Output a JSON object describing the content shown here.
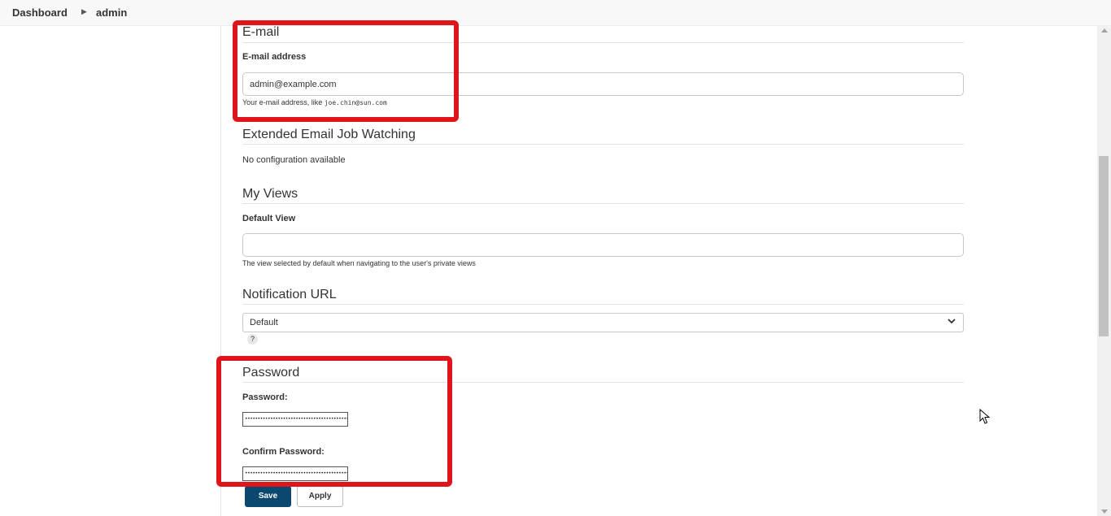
{
  "breadcrumb": {
    "items": [
      "Dashboard",
      "admin"
    ],
    "separator_icon": "chevron-right-icon"
  },
  "email": {
    "section_title": "E-mail",
    "field_label": "E-mail address",
    "value": "admin@example.com",
    "help_prefix": "Your e-mail address, like",
    "help_example": "joe.chin@sun.com"
  },
  "extended_email": {
    "section_title": "Extended Email Job Watching",
    "message": "No configuration available"
  },
  "my_views": {
    "section_title": "My Views",
    "field_label": "Default View",
    "value": "",
    "help": "The view selected by default when navigating to the user's private views"
  },
  "notification_url": {
    "section_title": "Notification URL",
    "selected": "Default",
    "help_icon": "?"
  },
  "password": {
    "section_title": "Password",
    "password_label": "Password:",
    "confirm_label": "Confirm Password:",
    "mask": "••••••••••••••••••••••••••••••••••••••••••••"
  },
  "actions": {
    "save_label": "Save",
    "apply_label": "Apply"
  },
  "colors": {
    "highlight": "#e0141b",
    "save_button": "#0b4870"
  }
}
